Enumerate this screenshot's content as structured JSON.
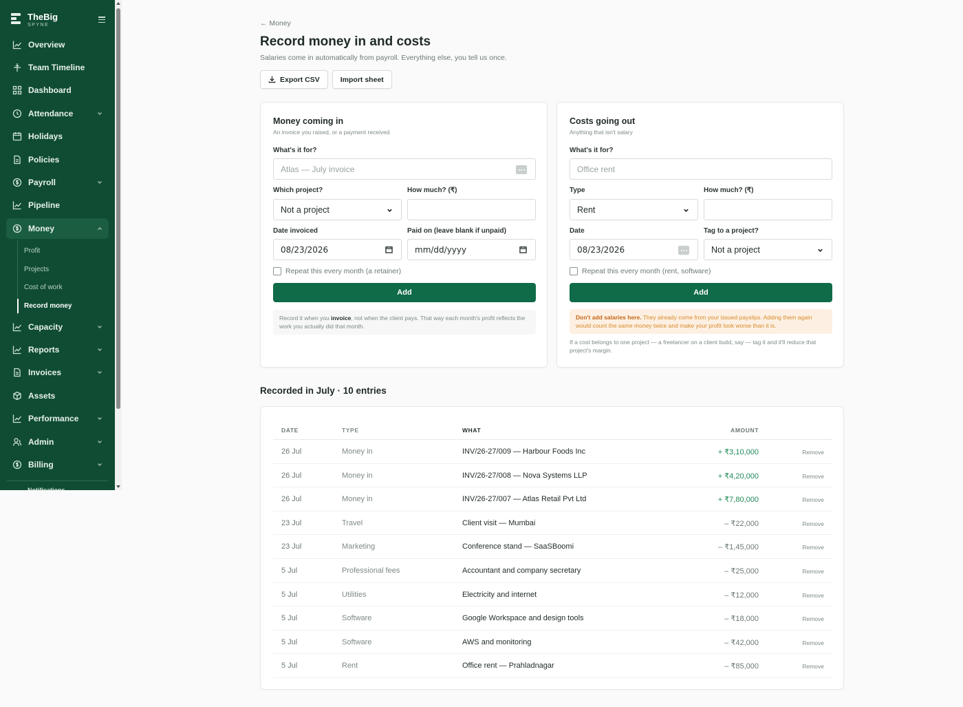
{
  "brand": {
    "name": "TheBig",
    "sub": "SPYNE"
  },
  "sidebar": {
    "items": [
      {
        "label": "Overview",
        "icon": "chart-line-icon",
        "chevron": false
      },
      {
        "label": "Team Timeline",
        "icon": "timeline-icon",
        "chevron": false
      },
      {
        "label": "Dashboard",
        "icon": "grid-icon",
        "chevron": false
      },
      {
        "label": "Attendance",
        "icon": "clock-icon",
        "chevron": true
      },
      {
        "label": "Holidays",
        "icon": "calendar-icon",
        "chevron": false
      },
      {
        "label": "Policies",
        "icon": "document-icon",
        "chevron": false
      },
      {
        "label": "Payroll",
        "icon": "coin-icon",
        "chevron": true
      },
      {
        "label": "Pipeline",
        "icon": "chart-line-icon",
        "chevron": false
      },
      {
        "label": "Money",
        "icon": "coin-icon",
        "chevron": true,
        "active": true
      },
      {
        "label": "Capacity",
        "icon": "chart-line-icon",
        "chevron": true
      },
      {
        "label": "Reports",
        "icon": "chart-line-icon",
        "chevron": true
      },
      {
        "label": "Invoices",
        "icon": "document-icon",
        "chevron": true
      },
      {
        "label": "Assets",
        "icon": "box-icon",
        "chevron": false
      },
      {
        "label": "Performance",
        "icon": "chart-line-icon",
        "chevron": true
      },
      {
        "label": "Admin",
        "icon": "users-icon",
        "chevron": true
      },
      {
        "label": "Billing",
        "icon": "coin-icon",
        "chevron": true
      }
    ],
    "money_sub": [
      "Profit",
      "Projects",
      "Cost of work",
      "Record money"
    ],
    "cut_label": "Notifications"
  },
  "header": {
    "breadcrumb": "← Money",
    "title": "Record money in and costs",
    "subtitle": "Salaries come in automatically from payroll. Everything else, you tell us once.",
    "export_label": "Export CSV",
    "import_label": "Import sheet"
  },
  "money_in": {
    "title": "Money coming in",
    "subtitle": "An invoice you raised, or a payment received",
    "what_label": "What's it for?",
    "what_placeholder": "Atlas — July invoice",
    "project_label": "Which project?",
    "project_value": "Not a project",
    "amount_label": "How much? (₹)",
    "amount_value": "",
    "date_label": "Date invoiced",
    "date_value": "08/23/2026",
    "paid_label": "Paid on (leave blank if unpaid)",
    "paid_value": "mm/dd/yyyy",
    "repeat_label": "Repeat this every month (a retainer)",
    "add_label": "Add",
    "note_pre": "Record it when you ",
    "note_bold": "invoice",
    "note_post": ", not when the client pays. That way each month's profit reflects the work you actually did that month."
  },
  "costs_out": {
    "title": "Costs going out",
    "subtitle": "Anything that isn't salary",
    "what_label": "What's it for?",
    "what_placeholder": "Office rent",
    "type_label": "Type",
    "type_value": "Rent",
    "amount_label": "How much? (₹)",
    "amount_value": "",
    "date_label": "Date",
    "date_value": "08/23/2026",
    "tag_label": "Tag to a project?",
    "tag_value": "Not a project",
    "repeat_label": "Repeat this every month (rent, software)",
    "add_label": "Add",
    "warn_bold": "Don't add salaries here.",
    "warn_text": " They already come from your issued payslips. Adding them again would count the same money twice and make your profit look worse than it is.",
    "after_note": "If a cost belongs to one project — a freelancer on a client build, say — tag it and it'll reduce that project's margin."
  },
  "recorded": {
    "title": "Recorded in July · 10 entries",
    "columns": {
      "date": "DATE",
      "type": "TYPE",
      "what": "WHAT",
      "amount": "AMOUNT"
    },
    "remove_label": "Remove",
    "rows": [
      {
        "date": "26 Jul",
        "type": "Money in",
        "what": "INV/26-27/009 — Harbour Foods Inc",
        "amount": "+ ₹3,10,000",
        "direction": "in"
      },
      {
        "date": "26 Jul",
        "type": "Money in",
        "what": "INV/26-27/008 — Nova Systems LLP",
        "amount": "+ ₹4,20,000",
        "direction": "in"
      },
      {
        "date": "26 Jul",
        "type": "Money in",
        "what": "INV/26-27/007 — Atlas Retail Pvt Ltd",
        "amount": "+ ₹7,80,000",
        "direction": "in"
      },
      {
        "date": "23 Jul",
        "type": "Travel",
        "what": "Client visit — Mumbai",
        "amount": "– ₹22,000",
        "direction": "out"
      },
      {
        "date": "23 Jul",
        "type": "Marketing",
        "what": "Conference stand — SaaSBoomi",
        "amount": "– ₹1,45,000",
        "direction": "out"
      },
      {
        "date": "5 Jul",
        "type": "Professional fees",
        "what": "Accountant and company secretary",
        "amount": "– ₹25,000",
        "direction": "out"
      },
      {
        "date": "5 Jul",
        "type": "Utilities",
        "what": "Electricity and internet",
        "amount": "– ₹12,000",
        "direction": "out"
      },
      {
        "date": "5 Jul",
        "type": "Software",
        "what": "Google Workspace and design tools",
        "amount": "– ₹18,000",
        "direction": "out"
      },
      {
        "date": "5 Jul",
        "type": "Software",
        "what": "AWS and monitoring",
        "amount": "– ₹42,000",
        "direction": "out"
      },
      {
        "date": "5 Jul",
        "type": "Rent",
        "what": "Office rent — Prahladnagar",
        "amount": "– ₹85,000",
        "direction": "out"
      }
    ]
  },
  "colors": {
    "sidebar": "#0f4c33",
    "accent": "#0f6b48",
    "in_amount": "#1e8a57",
    "warning": "#d78a2c"
  }
}
